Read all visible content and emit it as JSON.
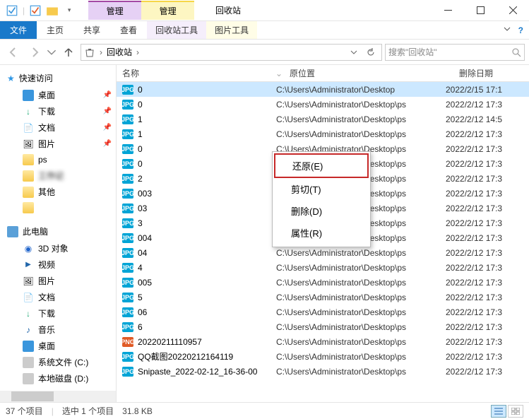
{
  "window": {
    "title": "回收站"
  },
  "qat": {
    "items": [
      "app",
      "props",
      "new",
      "more"
    ]
  },
  "tab_groups": [
    {
      "label": "管理",
      "sub": "回收站工具",
      "style": "purple"
    },
    {
      "label": "管理",
      "sub": "图片工具",
      "style": "yellow"
    }
  ],
  "ribbon_tabs": {
    "file": "文件",
    "home": "主页",
    "share": "共享",
    "view": "查看"
  },
  "address": {
    "root_icon": "recycle-bin",
    "crumbs": [
      "回收站"
    ],
    "sep": "›"
  },
  "search": {
    "placeholder": "搜索\"回收站\""
  },
  "tree": {
    "quick_access": {
      "label": "快速访问",
      "items": [
        {
          "icon": "desktop",
          "label": "桌面",
          "pinned": true
        },
        {
          "icon": "download",
          "label": "下载",
          "pinned": true
        },
        {
          "icon": "doc",
          "label": "文档",
          "pinned": true
        },
        {
          "icon": "pic",
          "label": "图片",
          "pinned": true
        },
        {
          "icon": "folder",
          "label": "ps",
          "pinned": false
        },
        {
          "icon": "folder",
          "label": "工作记",
          "pinned": false,
          "blurred": true
        },
        {
          "icon": "folder",
          "label": "其他",
          "pinned": false
        },
        {
          "icon": "folder",
          "label": "",
          "pinned": false,
          "blurred": true
        }
      ]
    },
    "this_pc": {
      "label": "此电脑",
      "items": [
        {
          "icon": "3d",
          "label": "3D 对象"
        },
        {
          "icon": "vid",
          "label": "视频"
        },
        {
          "icon": "pic",
          "label": "图片"
        },
        {
          "icon": "doc",
          "label": "文档"
        },
        {
          "icon": "download",
          "label": "下载"
        },
        {
          "icon": "mus",
          "label": "音乐"
        },
        {
          "icon": "desktop",
          "label": "桌面"
        },
        {
          "icon": "drive",
          "label": "系统文件 (C:)"
        },
        {
          "icon": "drive",
          "label": "本地磁盘 (D:)"
        }
      ]
    }
  },
  "columns": {
    "name": "名称",
    "orig": "原位置",
    "deleted": "删除日期"
  },
  "files": [
    {
      "type": "jpg",
      "name": "0",
      "orig": "C:\\Users\\Administrator\\Desktop",
      "del": "2022/2/15 17:1",
      "selected": true
    },
    {
      "type": "jpg",
      "name": "0",
      "orig": "C:\\Users\\Administrator\\Desktop\\ps",
      "del": "2022/2/12 17:3"
    },
    {
      "type": "jpg",
      "name": "1",
      "orig": "C:\\Users\\Administrator\\Desktop\\ps",
      "del": "2022/2/12 14:5"
    },
    {
      "type": "jpg",
      "name": "1",
      "orig": "C:\\Users\\Administrator\\Desktop\\ps",
      "del": "2022/2/12 17:3"
    },
    {
      "type": "jpg",
      "name": "0",
      "orig": "C:\\Users\\Administrator\\Desktop\\ps",
      "del": "2022/2/12 17:3"
    },
    {
      "type": "jpg",
      "name": "0",
      "orig": "C:\\Users\\Administrator\\Desktop\\ps",
      "del": "2022/2/12 17:3"
    },
    {
      "type": "jpg",
      "name": "2",
      "orig": "C:\\Users\\Administrator\\Desktop\\ps",
      "del": "2022/2/12 17:3"
    },
    {
      "type": "jpg",
      "name": "003",
      "orig": "C:\\Users\\Administrator\\Desktop\\ps",
      "del": "2022/2/12 17:3"
    },
    {
      "type": "jpg",
      "name": "03",
      "orig": "C:\\Users\\Administrator\\Desktop\\ps",
      "del": "2022/2/12 17:3"
    },
    {
      "type": "jpg",
      "name": "3",
      "orig": "C:\\Users\\Administrator\\Desktop\\ps",
      "del": "2022/2/12 17:3"
    },
    {
      "type": "jpg",
      "name": "004",
      "orig": "C:\\Users\\Administrator\\Desktop\\ps",
      "del": "2022/2/12 17:3"
    },
    {
      "type": "jpg",
      "name": "04",
      "orig": "C:\\Users\\Administrator\\Desktop\\ps",
      "del": "2022/2/12 17:3"
    },
    {
      "type": "jpg",
      "name": "4",
      "orig": "C:\\Users\\Administrator\\Desktop\\ps",
      "del": "2022/2/12 17:3"
    },
    {
      "type": "jpg",
      "name": "005",
      "orig": "C:\\Users\\Administrator\\Desktop\\ps",
      "del": "2022/2/12 17:3"
    },
    {
      "type": "jpg",
      "name": "5",
      "orig": "C:\\Users\\Administrator\\Desktop\\ps",
      "del": "2022/2/12 17:3"
    },
    {
      "type": "jpg",
      "name": "06",
      "orig": "C:\\Users\\Administrator\\Desktop\\ps",
      "del": "2022/2/12 17:3"
    },
    {
      "type": "jpg",
      "name": "6",
      "orig": "C:\\Users\\Administrator\\Desktop\\ps",
      "del": "2022/2/12 17:3"
    },
    {
      "type": "png",
      "name": "20220211110957",
      "orig": "C:\\Users\\Administrator\\Desktop\\ps",
      "del": "2022/2/12 17:3"
    },
    {
      "type": "jpg",
      "name": "QQ截图20220212164119",
      "orig": "C:\\Users\\Administrator\\Desktop\\ps",
      "del": "2022/2/12 17:3"
    },
    {
      "type": "jpg",
      "name": "Snipaste_2022-02-12_16-36-00",
      "orig": "C:\\Users\\Administrator\\Desktop\\ps",
      "del": "2022/2/12 17:3"
    }
  ],
  "context_menu": {
    "items": [
      {
        "key": "restore",
        "label": "还原(E)",
        "hot": true
      },
      {
        "key": "cut",
        "label": "剪切(T)"
      },
      {
        "key": "delete",
        "label": "删除(D)"
      },
      {
        "key": "properties",
        "label": "属性(R)"
      }
    ]
  },
  "status": {
    "count": "37 个项目",
    "selected": "选中 1 个项目",
    "size": "31.8 KB"
  }
}
